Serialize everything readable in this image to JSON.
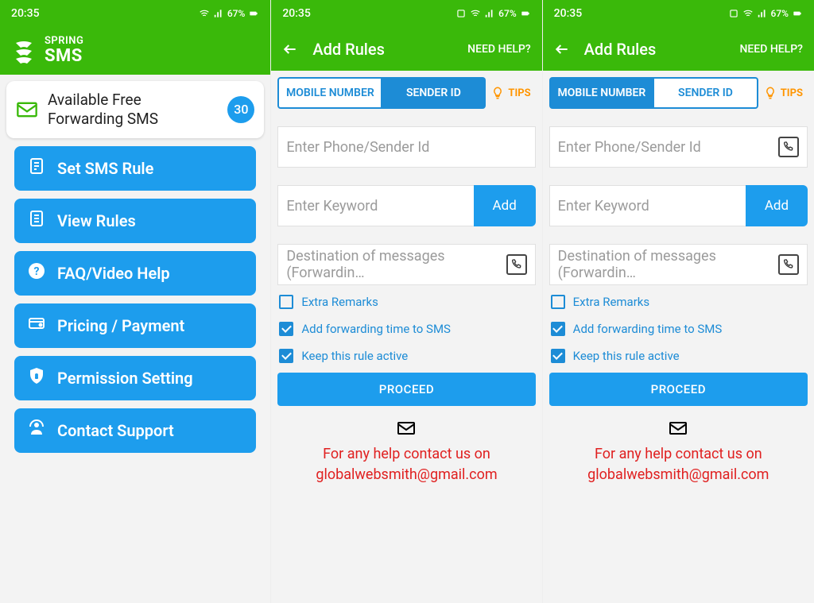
{
  "statusbar": {
    "time": "20:35",
    "battery": "67%"
  },
  "screen1": {
    "brand_small": "SPRING",
    "brand_big": "SMS",
    "card_title": "Available Free Forwarding SMS",
    "card_count": "30",
    "menu": [
      {
        "name": "set-sms-rule",
        "label": "Set SMS Rule",
        "icon": "rule"
      },
      {
        "name": "view-rules",
        "label": "View Rules",
        "icon": "list"
      },
      {
        "name": "faq",
        "label": "FAQ/Video Help",
        "icon": "help"
      },
      {
        "name": "pricing",
        "label": "Pricing / Payment",
        "icon": "pay"
      },
      {
        "name": "permission",
        "label": "Permission Setting",
        "icon": "shield"
      },
      {
        "name": "contact",
        "label": "Contact Support",
        "icon": "support"
      }
    ]
  },
  "add_rules": {
    "title": "Add Rules",
    "need_help": "NEED HELP?",
    "tab_mobile": "MOBILE NUMBER",
    "tab_sender": "SENDER ID",
    "tips": "TIPS",
    "ph_phone": "Enter Phone/Sender Id",
    "ph_keyword": "Enter Keyword",
    "add": "Add",
    "ph_dest": "Destination of messages (Forwardin…",
    "extra_remarks": "Extra Remarks",
    "fwd_time": "Add forwarding time to SMS",
    "keep_active": "Keep this rule active",
    "proceed": "PROCEED",
    "help_line1": "For any help contact us on",
    "help_line2": "globalwebsmith@gmail.com"
  },
  "panels": [
    {
      "active_tab": "mobile",
      "show_contact_icon_on_phone": false
    },
    {
      "active_tab": "sender",
      "show_contact_icon_on_phone": true
    }
  ]
}
